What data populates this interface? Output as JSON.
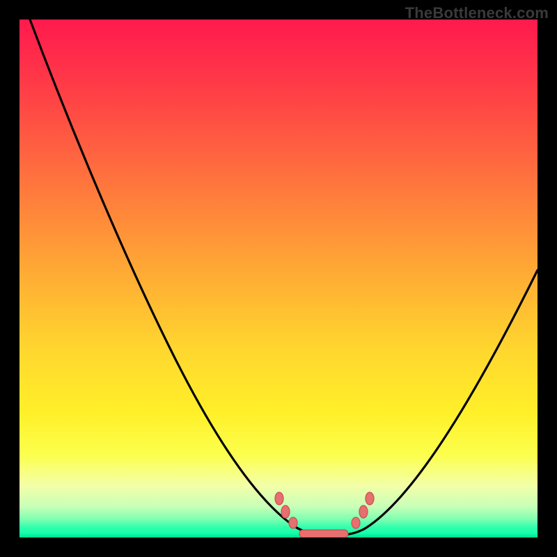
{
  "branding": "TheBottleneck.com",
  "chart_data": {
    "type": "line",
    "title": "",
    "xlabel": "",
    "ylabel": "",
    "xlim": [
      0,
      100
    ],
    "ylim": [
      0,
      100
    ],
    "grid": false,
    "legend": false,
    "series": [
      {
        "name": "bottleneck-curve",
        "x": [
          2,
          6,
          10,
          14,
          18,
          22,
          26,
          30,
          34,
          38,
          42,
          46,
          50,
          52,
          54,
          56,
          58,
          60,
          62,
          66,
          70,
          74,
          78,
          82,
          86,
          90,
          94,
          98,
          100
        ],
        "values": [
          100,
          92,
          84,
          76,
          69,
          61,
          54,
          47,
          40,
          33,
          27,
          21,
          14,
          10,
          6,
          3,
          1,
          0,
          0,
          1,
          4,
          9,
          15,
          22,
          29,
          37,
          44,
          49,
          52
        ]
      }
    ],
    "markers": [
      {
        "name": "marker-cluster-left",
        "x": 52,
        "y": 10
      },
      {
        "name": "marker-cluster-left2",
        "x": 53,
        "y": 6
      },
      {
        "name": "marker-cluster-left3",
        "x": 55,
        "y": 3
      },
      {
        "name": "marker-flat-1",
        "x": 57,
        "y": 0.8
      },
      {
        "name": "marker-flat-2",
        "x": 59,
        "y": 0.5
      },
      {
        "name": "marker-flat-3",
        "x": 61,
        "y": 0.5
      },
      {
        "name": "marker-flat-4",
        "x": 63,
        "y": 0.8
      },
      {
        "name": "marker-cluster-right",
        "x": 66,
        "y": 3
      },
      {
        "name": "marker-cluster-right2",
        "x": 67,
        "y": 6
      },
      {
        "name": "marker-cluster-right3",
        "x": 68,
        "y": 10
      }
    ],
    "colors": {
      "curve": "#000000",
      "marker_fill": "#e76f6f",
      "marker_stroke": "#c94f4f",
      "gradient_top": "#ff1a4d",
      "gradient_mid": "#ffd72e",
      "gradient_bottom": "#00ffa6"
    }
  }
}
